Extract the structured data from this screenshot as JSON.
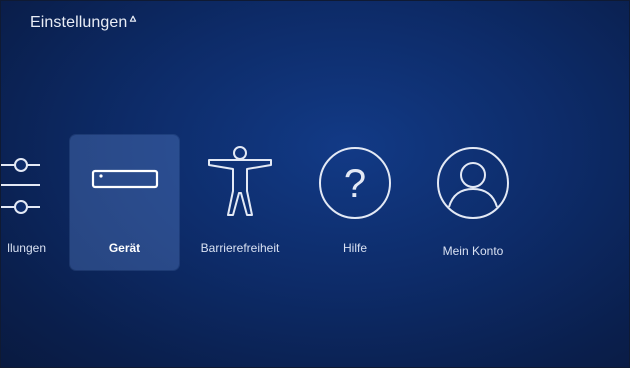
{
  "header": {
    "title": "Einstellungen"
  },
  "menu": {
    "items": [
      {
        "id": "settings",
        "label": "llungen",
        "icon": "sliders-icon",
        "selected": false
      },
      {
        "id": "device",
        "label": "Gerät",
        "icon": "device-icon",
        "selected": true
      },
      {
        "id": "accessibility",
        "label": "Barrierefreiheit",
        "icon": "accessibility-icon",
        "selected": false
      },
      {
        "id": "help",
        "label": "Hilfe",
        "icon": "help-icon",
        "selected": false
      },
      {
        "id": "account",
        "label": "Mein Konto",
        "icon": "account-icon",
        "selected": false
      }
    ]
  },
  "colors": {
    "background": "#0d2b68",
    "selected_tile": "#4d6fa8",
    "text": "#e6ecf8"
  }
}
